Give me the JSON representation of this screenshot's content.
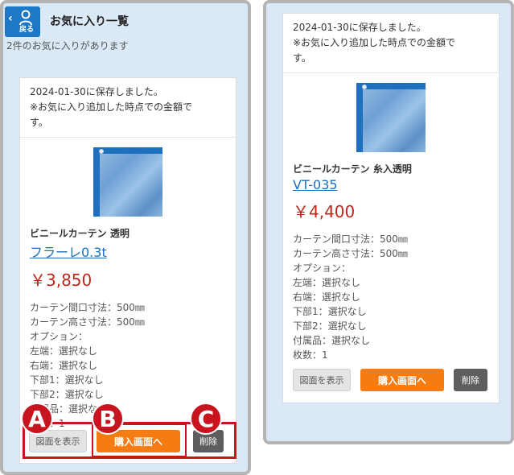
{
  "header": {
    "back_label": "戻る",
    "title": "お気に入り一覧"
  },
  "fav_count": "2件のお気に入りがあります",
  "left_card": {
    "saved_line1": "2024-01-30に保存しました。",
    "saved_line2": "※お気に入り追加した時点での金額で",
    "saved_line3": "す。",
    "name": "ビニールカーテン 透明",
    "code": "フラーレ0.3t",
    "price": "￥3,850",
    "specs": [
      "カーテン間口寸法：500㎜",
      "カーテン高さ寸法：500㎜",
      "オプション：",
      "左端：選択なし",
      "右端：選択なし",
      "下部1：選択なし",
      "下部2：選択なし",
      "付属品：選択なし",
      "枚数：1"
    ],
    "btn_figure": "図面を表示",
    "btn_buy": "購入画面へ",
    "btn_delete": "削除"
  },
  "right_card": {
    "saved_line1": "2024-01-30に保存しました。",
    "saved_line2": "※お気に入り追加した時点での金額で",
    "saved_line3": "す。",
    "name": "ビニールカーテン 糸入透明",
    "code": "VT-035",
    "price": "￥4,400",
    "specs": [
      "カーテン間口寸法：500㎜",
      "カーテン高さ寸法：500㎜",
      "オプション：",
      "左端：選択なし",
      "右端：選択なし",
      "下部1：選択なし",
      "下部2：選択なし",
      "付属品：選択なし",
      "枚数：1"
    ],
    "btn_figure": "図面を表示",
    "btn_buy": "購入画面へ",
    "btn_delete": "削除"
  },
  "callouts": {
    "a": "A",
    "b": "B",
    "c": "C"
  },
  "colors": {
    "header_blue": "#1e78c8",
    "buy_orange": "#f57c12",
    "price_red": "#c0271c",
    "callout_red": "#c8141e",
    "delete_gray": "#5e5e5e"
  }
}
